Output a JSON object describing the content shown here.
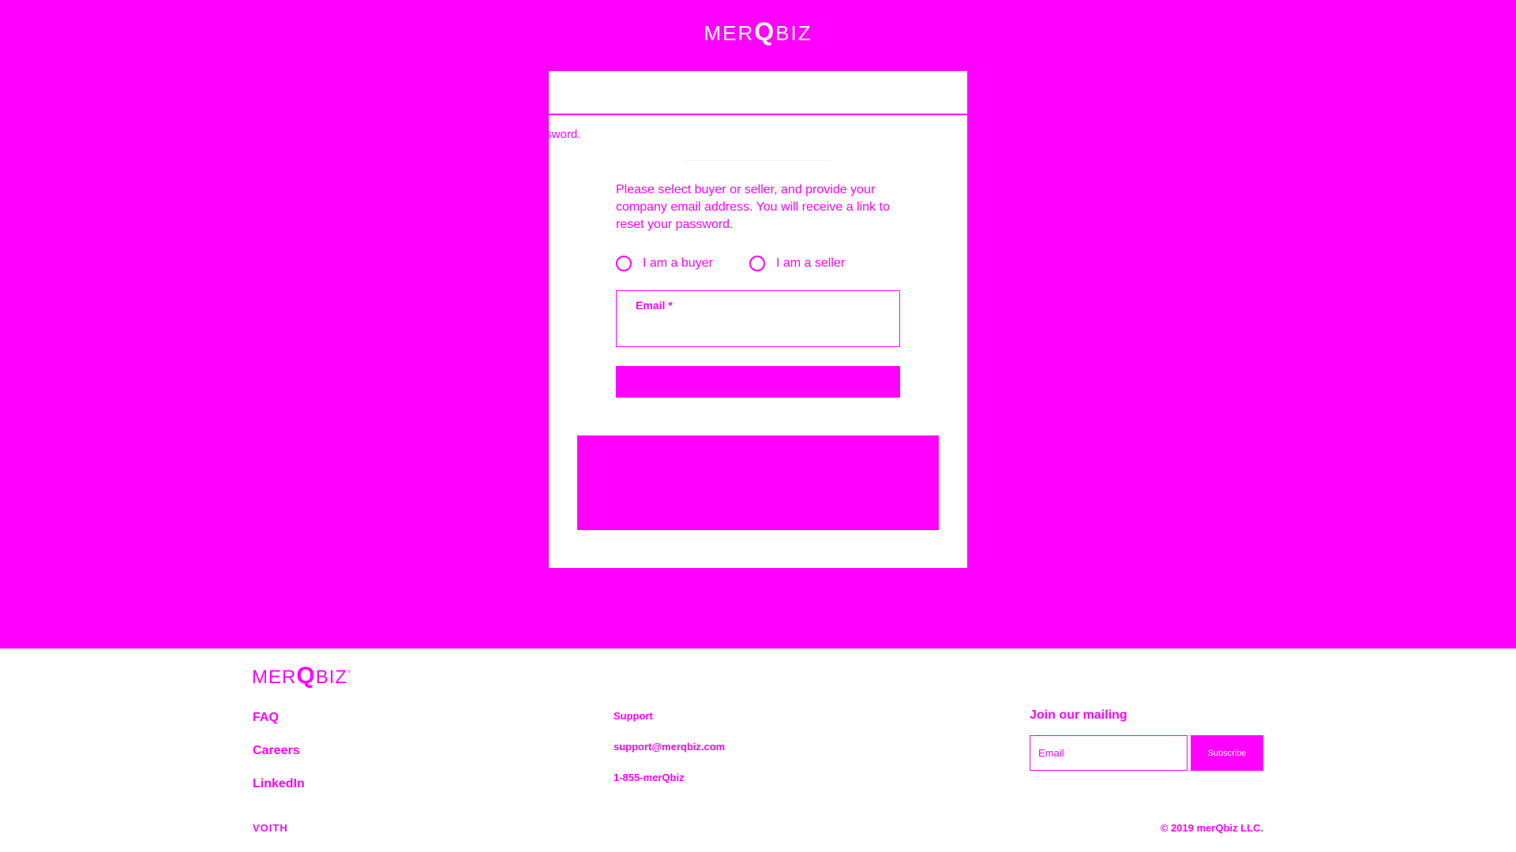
{
  "brand": {
    "logo_prefix": "MER",
    "logo_q": "Q",
    "logo_suffix": "BIZ",
    "accent": "#ff00ff"
  },
  "card": {
    "overflow_text": "password.",
    "instructions": "Please select buyer or seller, and provide your company email address. You will receive a link to reset your password.",
    "radio_buyer_label": "I am a buyer",
    "radio_seller_label": "I am a seller",
    "email_label": "Email *",
    "email_value": ""
  },
  "footer": {
    "logo_prefix": "MER",
    "logo_q": "Q",
    "logo_suffix": "BIZ",
    "logo_mark": "°",
    "links": [
      "FAQ",
      "Careers",
      "LinkedIn"
    ],
    "support_title": "Support",
    "support_email": "support@merqbiz.com",
    "support_phone": "1-855-merQbiz",
    "mailing_title": "Join our mailing",
    "mailing_placeholder": "Email",
    "subscribe_label": "Subscribe",
    "voith": "VOITH",
    "copyright": "© 2019 merQbiz LLC."
  }
}
